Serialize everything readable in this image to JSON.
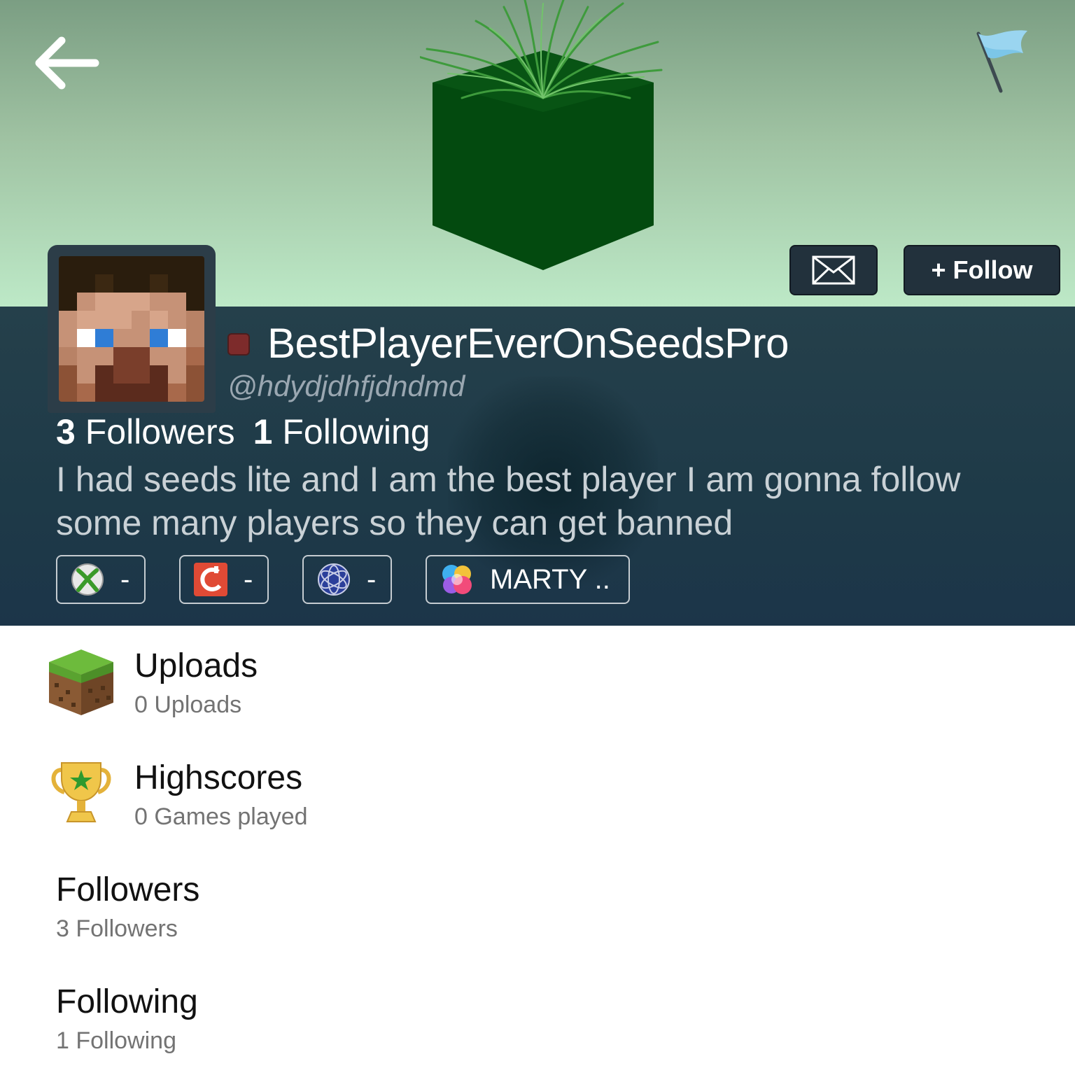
{
  "profile": {
    "display_name": "BestPlayerEverOnSeedsPro",
    "handle": "@hdydjdhfjdndmd",
    "followers_count": "3",
    "followers_label": "Followers",
    "following_count": "1",
    "following_label": "Following",
    "bio": "I had seeds lite and I am the best player I am gonna follow some many players so they can get banned",
    "status_color": "#7d2b2b"
  },
  "header": {
    "follow_label": "+ Follow",
    "background_top": "#7b9e83",
    "background_bottom": "#bde9c7",
    "cube_color": "#034a0f"
  },
  "platforms": [
    {
      "icon": "xbox-icon",
      "value": "-"
    },
    {
      "icon": "mojang-icon",
      "value": "-"
    },
    {
      "icon": "playstation-network-icon",
      "value": "-"
    },
    {
      "icon": "game-center-icon",
      "value": "MARTY .."
    }
  ],
  "sections": [
    {
      "icon": "grass-block-icon",
      "title": "Uploads",
      "subtitle": "0 Uploads"
    },
    {
      "icon": "trophy-icon",
      "title": "Highscores",
      "subtitle": "0 Games played"
    },
    {
      "title": "Followers",
      "subtitle": "3 Followers"
    },
    {
      "title": "Following",
      "subtitle": "1 Following"
    }
  ]
}
